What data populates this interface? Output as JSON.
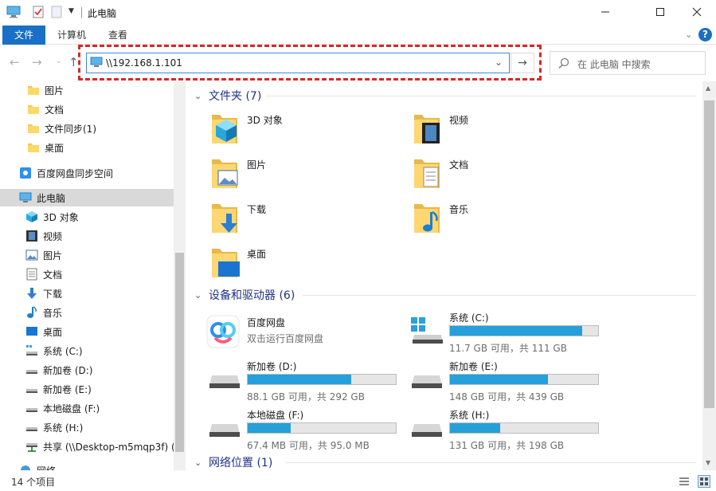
{
  "window": {
    "title": "此电脑",
    "minimize_icon": "minimize-icon",
    "maximize_icon": "maximize-icon",
    "close_icon": "close-icon"
  },
  "ribbon": {
    "tabs": [
      "文件",
      "计算机",
      "查看"
    ]
  },
  "address": {
    "value": "\\\\192.168.1.101",
    "go_glyph": "→"
  },
  "search": {
    "placeholder": "在 此电脑 中搜索"
  },
  "sidebar": {
    "items": [
      {
        "label": "图片",
        "icon": "folder-icon"
      },
      {
        "label": "文档",
        "icon": "folder-icon"
      },
      {
        "label": "文件同步(1)",
        "icon": "folder-icon"
      },
      {
        "label": "桌面",
        "icon": "folder-icon"
      },
      {
        "label": "百度网盘同步空间",
        "icon": "baidu-sync-icon"
      },
      {
        "label": "此电脑",
        "icon": "computer-icon"
      },
      {
        "label": "3D 对象",
        "icon": "3d-objects-icon"
      },
      {
        "label": "视频",
        "icon": "video-icon"
      },
      {
        "label": "图片",
        "icon": "picture-icon"
      },
      {
        "label": "文档",
        "icon": "document-icon"
      },
      {
        "label": "下载",
        "icon": "download-icon"
      },
      {
        "label": "音乐",
        "icon": "music-icon"
      },
      {
        "label": "桌面",
        "icon": "desktop-icon"
      },
      {
        "label": "系统 (C:)",
        "icon": "drive-icon"
      },
      {
        "label": "新加卷 (D:)",
        "icon": "drive-icon"
      },
      {
        "label": "新加卷 (E:)",
        "icon": "drive-icon"
      },
      {
        "label": "本地磁盘 (F:)",
        "icon": "drive-icon"
      },
      {
        "label": "系统 (H:)",
        "icon": "drive-icon"
      },
      {
        "label": "共享 (\\\\Desktop-m5mqp3f) (",
        "icon": "network-drive-icon"
      },
      {
        "label": "网络",
        "icon": "network-icon"
      }
    ]
  },
  "content": {
    "folders_header": "文件夹 (7)",
    "folders": [
      {
        "label": "3D 对象"
      },
      {
        "label": "视频"
      },
      {
        "label": "图片"
      },
      {
        "label": "文档"
      },
      {
        "label": "下载"
      },
      {
        "label": "音乐"
      },
      {
        "label": "桌面"
      }
    ],
    "devices_header": "设备和驱动器 (6)",
    "baidu": {
      "name": "百度网盘",
      "sub": "双击运行百度网盘"
    },
    "drives": [
      {
        "name": "系统 (C:)",
        "free": "11.7 GB 可用，共 111 GB",
        "used_fraction": 0.895
      },
      {
        "name": "新加卷 (D:)",
        "free": "88.1 GB 可用，共 292 GB",
        "used_fraction": 0.698
      },
      {
        "name": "新加卷 (E:)",
        "free": "148 GB 可用，共 439 GB",
        "used_fraction": 0.663
      },
      {
        "name": "本地磁盘 (F:)",
        "free": "67.4 MB 可用，共 95.0 MB",
        "used_fraction": 0.29
      },
      {
        "name": "系统 (H:)",
        "free": "131 GB 可用，共 198 GB",
        "used_fraction": 0.338
      }
    ],
    "network_header": "网络位置 (1)"
  },
  "status": {
    "count": "14 个项目"
  },
  "colors": {
    "accent": "#1a6fc6",
    "drive_bar": "#26a0da",
    "highlight_border": "#d42a2a",
    "group_header": "#1e3287"
  }
}
